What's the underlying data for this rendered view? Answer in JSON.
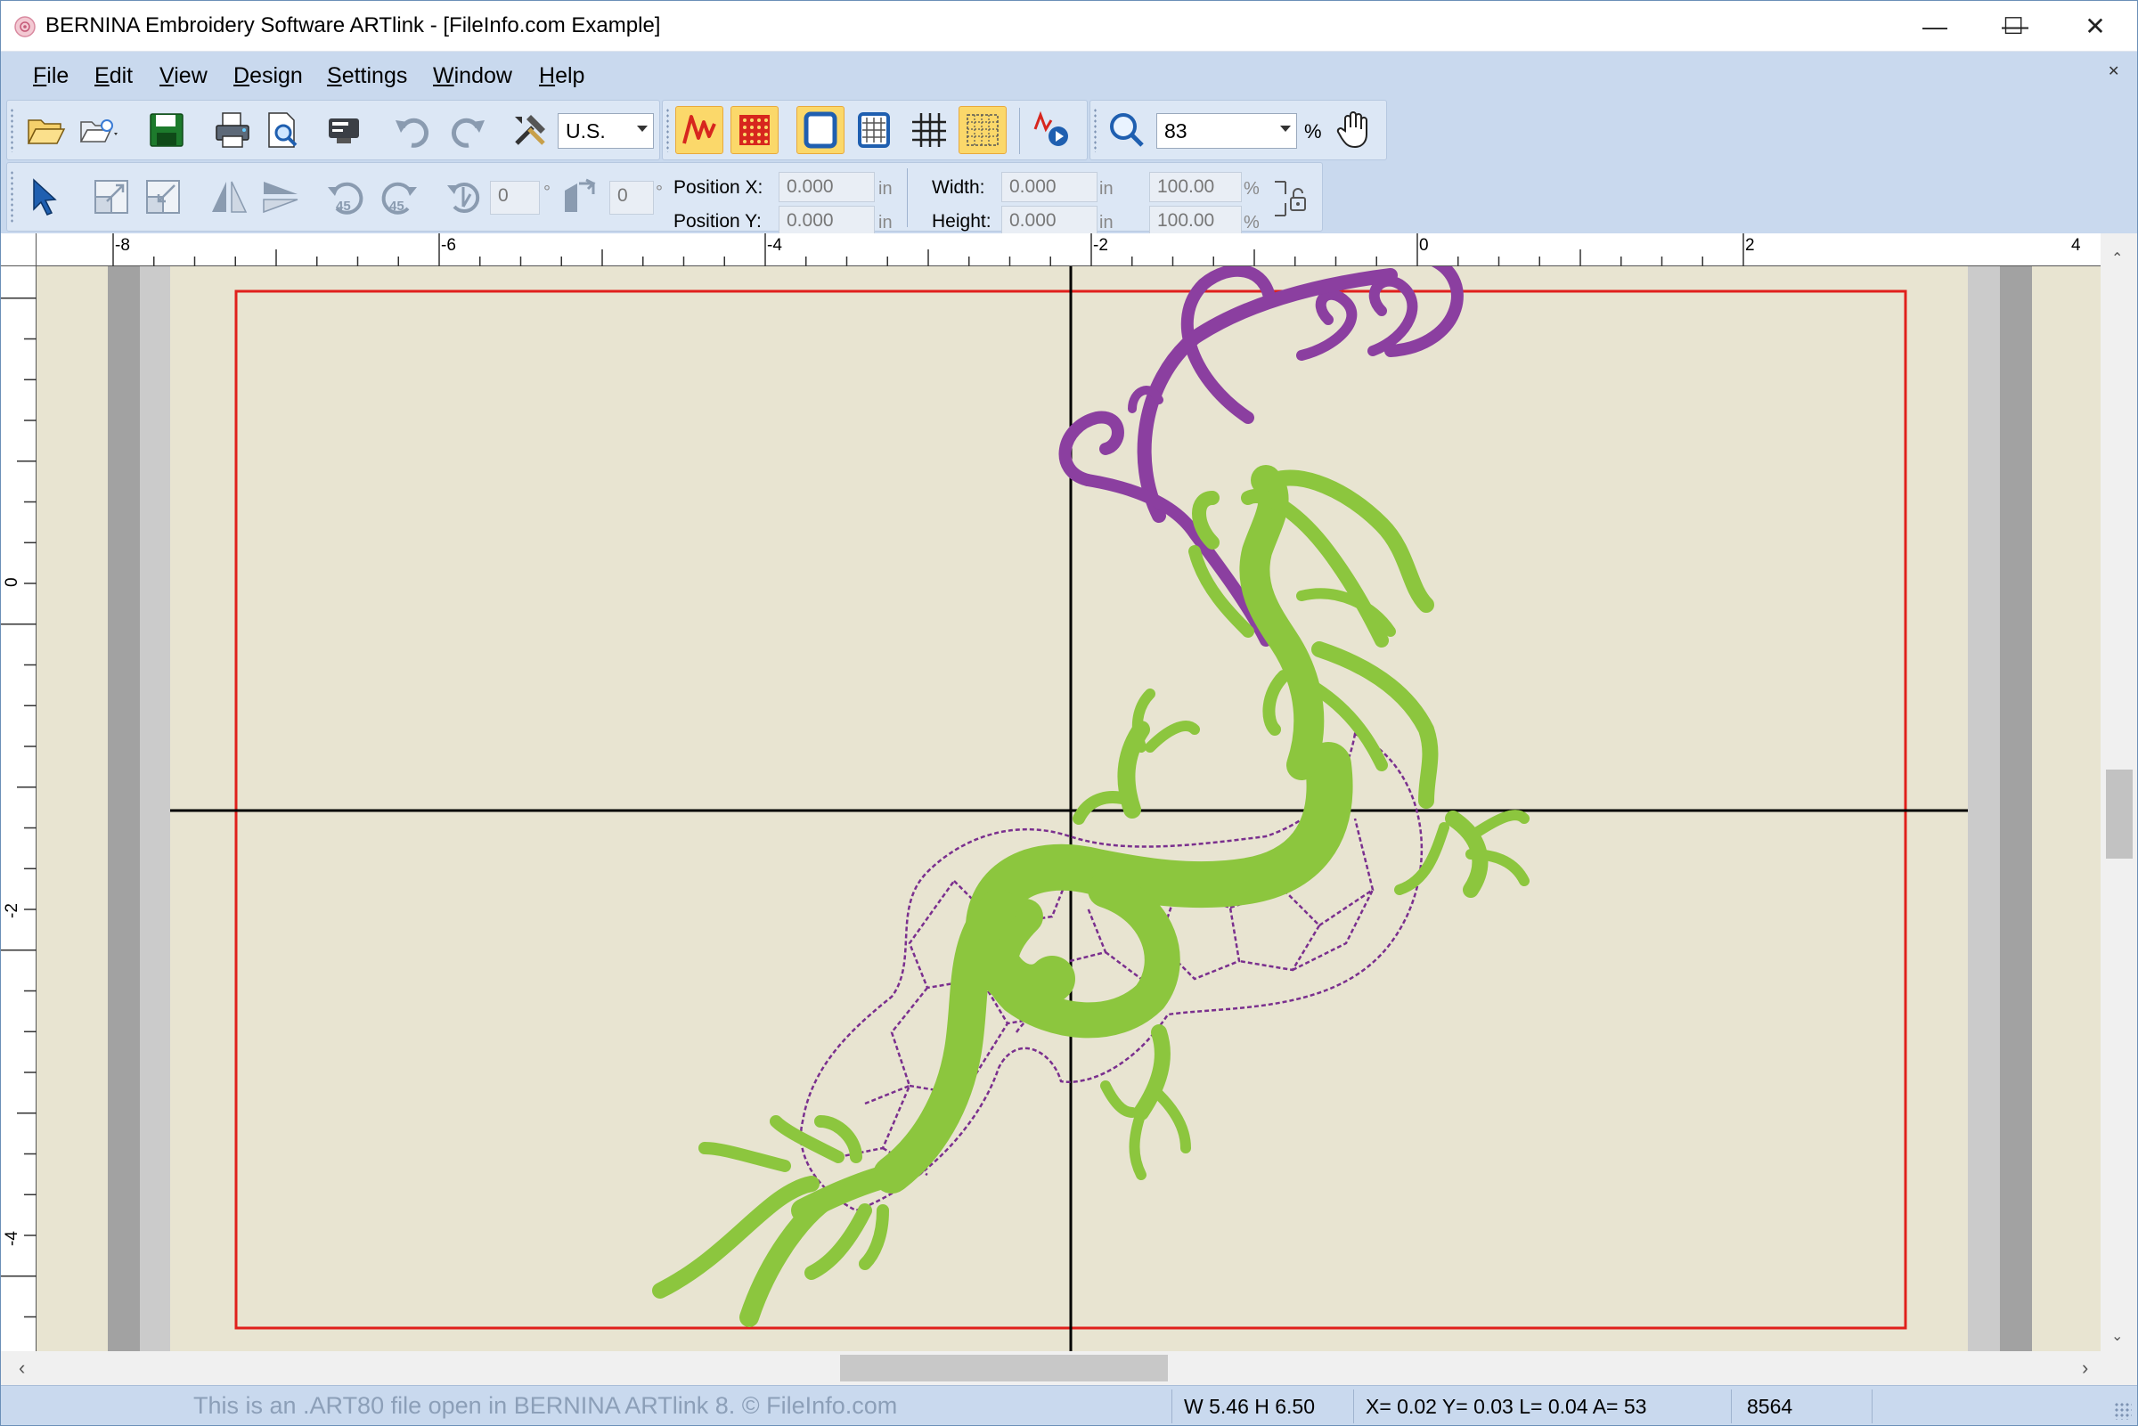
{
  "window": {
    "title": "BERNINA Embroidery Software ARTlink - [FileInfo.com Example]",
    "minimize_glyph": "—",
    "maximize_glyph": "☐",
    "close_glyph": "✕"
  },
  "menu": {
    "items": [
      "File",
      "Edit",
      "View",
      "Design",
      "Settings",
      "Window",
      "Help"
    ],
    "close_glyph": "✕"
  },
  "toolbar": {
    "units_value": "U.S.",
    "zoom_value": "83",
    "zoom_unit": "%",
    "icons": [
      "open-folder-icon",
      "open-recent-icon",
      "save-icon",
      "print-icon",
      "print-preview-icon",
      "send-to-machine-icon",
      "undo-icon",
      "redo-icon",
      "tools-icon",
      "stitch-mode-icon",
      "fill-pattern-icon",
      "hoop-icon",
      "grid-hoop-icon",
      "grid-icon",
      "grid-settings-icon",
      "stitch-player-icon",
      "zoom-icon",
      "pan-hand-icon"
    ]
  },
  "transform": {
    "rotate_value": "0",
    "rotate_unit": "°",
    "skew_value": "0",
    "skew_unit": "°",
    "position_x_label": "Position X:",
    "position_x_value": "0.000",
    "position_y_label": "Position Y:",
    "position_y_value": "0.000",
    "pos_unit": "in",
    "width_label": "Width:",
    "width_value": "0.000",
    "height_label": "Height:",
    "height_value": "0.000",
    "size_unit": "in",
    "width_pct": "100.00",
    "height_pct": "100.00",
    "pct_unit": "%"
  },
  "rulers": {
    "top_labels": [
      "-8",
      "-6",
      "-4",
      "-2",
      "0",
      "2",
      "4"
    ],
    "left_labels": [
      "0",
      "-2",
      "-4"
    ]
  },
  "colors": {
    "canvas": "#e8e4d1",
    "hoop_outline": "#e0201c",
    "thread_green": "#8cc63e",
    "thread_purple": "#8b3fa0",
    "toolbar_bg": "#c9d9ee"
  },
  "status": {
    "message": "This is an .ART80 file open in BERNINA ARTlink 8. © FileInfo.com",
    "size": "W 5.46 H 6.50",
    "coords": "X= 0.02 Y= 0.03 L= 0.04 A=  53",
    "stitch_count": "8564"
  }
}
